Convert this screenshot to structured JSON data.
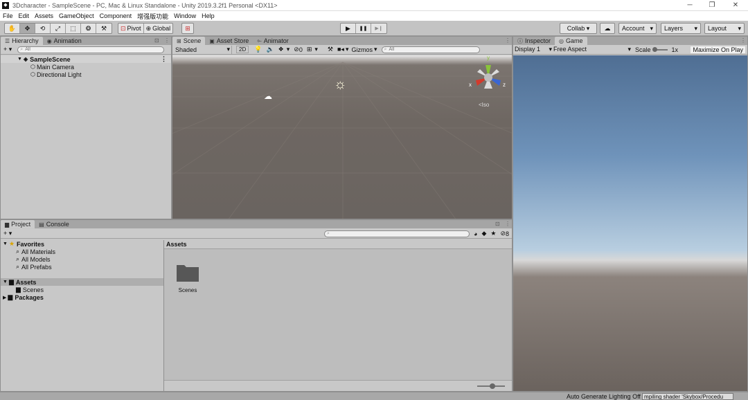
{
  "window": {
    "title": "3Dcharacter - SampleScene - PC, Mac & Linux Standalone - Unity 2019.3.2f1 Personal <DX11>",
    "app_icon": "unity-logo-icon",
    "controls": [
      "─",
      "❐",
      "✕"
    ]
  },
  "menu": [
    "File",
    "Edit",
    "Assets",
    "GameObject",
    "Component",
    "增强版功能",
    "Window",
    "Help"
  ],
  "toolbar": {
    "tools": [
      "✋",
      "✥",
      "⟲",
      "⤢",
      "⬚",
      "❂",
      "⚒"
    ],
    "pivot_label": "Pivot",
    "global_label": "Global",
    "play": "▶",
    "pause": "❚❚",
    "step": "▶❙",
    "collab_label": "Collab ▾",
    "cloud_icon": "☁",
    "account_label": "Account",
    "layers_label": "Layers",
    "layout_label": "Layout"
  },
  "hierarchy": {
    "tab_label": "Hierarchy",
    "animation_tab_label": "Animation",
    "add_label": "+ ▾",
    "search_placeholder": "All",
    "scene_name": "SampleScene",
    "items": [
      "Main Camera",
      "Directional Light"
    ]
  },
  "scene": {
    "tabs": {
      "scene": "Scene",
      "asset_store": "Asset Store",
      "animator": "Animator"
    },
    "shading": "Shaded",
    "mode_2d": "2D",
    "hidden_count": "0",
    "gizmos_label": "Gizmos",
    "search_placeholder": "All",
    "iso_label": "Iso",
    "axis_labels": {
      "x": "x",
      "y": "y",
      "z": "z"
    },
    "colors": {
      "x": "#d33a2c",
      "y": "#8ac43a",
      "z": "#3a66d3"
    }
  },
  "inspector": {
    "inspector_tab": "Inspector",
    "game_tab": "Game",
    "display": "Display 1",
    "aspect": "Free Aspect",
    "scale_label": "Scale",
    "scale_value": "1x",
    "maximize_label": "Maximize On Play"
  },
  "project": {
    "project_tab": "Project",
    "console_tab": "Console",
    "add_label": "+ ▾",
    "hidden_count": "8",
    "favorites_label": "Favorites",
    "favorites": [
      "All Materials",
      "All Models",
      "All Prefabs"
    ],
    "assets_label": "Assets",
    "assets_children": [
      "Scenes"
    ],
    "packages_label": "Packages",
    "breadcrumb": "Assets",
    "folders": [
      "Scenes"
    ]
  },
  "status": {
    "lighting": "Auto Generate Lighting Off",
    "message": "mpiling shader 'Skybox/Procedu"
  }
}
